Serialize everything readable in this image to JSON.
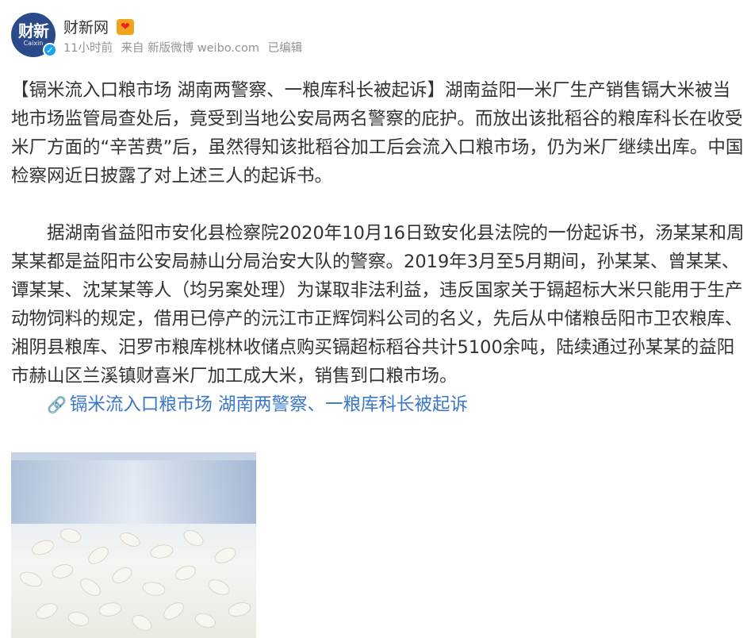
{
  "post": {
    "author": "财新网",
    "avatar_text": "财新",
    "avatar_subtext": "Caixin",
    "meta": {
      "time": "11小时前",
      "source": "来自 新版微博 weibo.com",
      "edited": "已编辑"
    },
    "paragraphs": [
      "【镉米流入口粮市场 湖南两警察、一粮库科长被起诉】湖南益阳一米厂生产销售镉大米被当地市场监管局查处后，竟受到当地公安局两名警察的庇护。而放出该批稻谷的粮库科长在收受米厂方面的“辛苦费”后，虽然得知该批稻谷加工后会流入口粮市场，仍为米厂继续出库。中国检察网近日披露了对上述三人的起诉书。",
      "据湖南省益阳市安化县检察院2020年10月16日致安化县法院的一份起诉书，汤某某和周某某都是益阳市公安局赫山分局治安大队的警察。2019年3月至5月期间，孙某某、曾某某、谭某某、沈某某等人（均另案处理）为谋取非法利益，违反国家关于镉超标大米只能用于生产动物饲料的规定，借用已停产的沅江市正辉饲料公司的名义，先后从中储粮岳阳市卫农粮库、湘阴县粮库、汨罗市粮库桃林收储点购买镉超标稻谷共计5100余吨，陆续通过孙某某的益阳市赫山区兰溪镇财喜米厂加工成大米，销售到口粮市场。"
    ],
    "link_text": "镉米流入口粮市场 湖南两警察、一粮库科长被起诉",
    "link_icon": "link-icon"
  }
}
